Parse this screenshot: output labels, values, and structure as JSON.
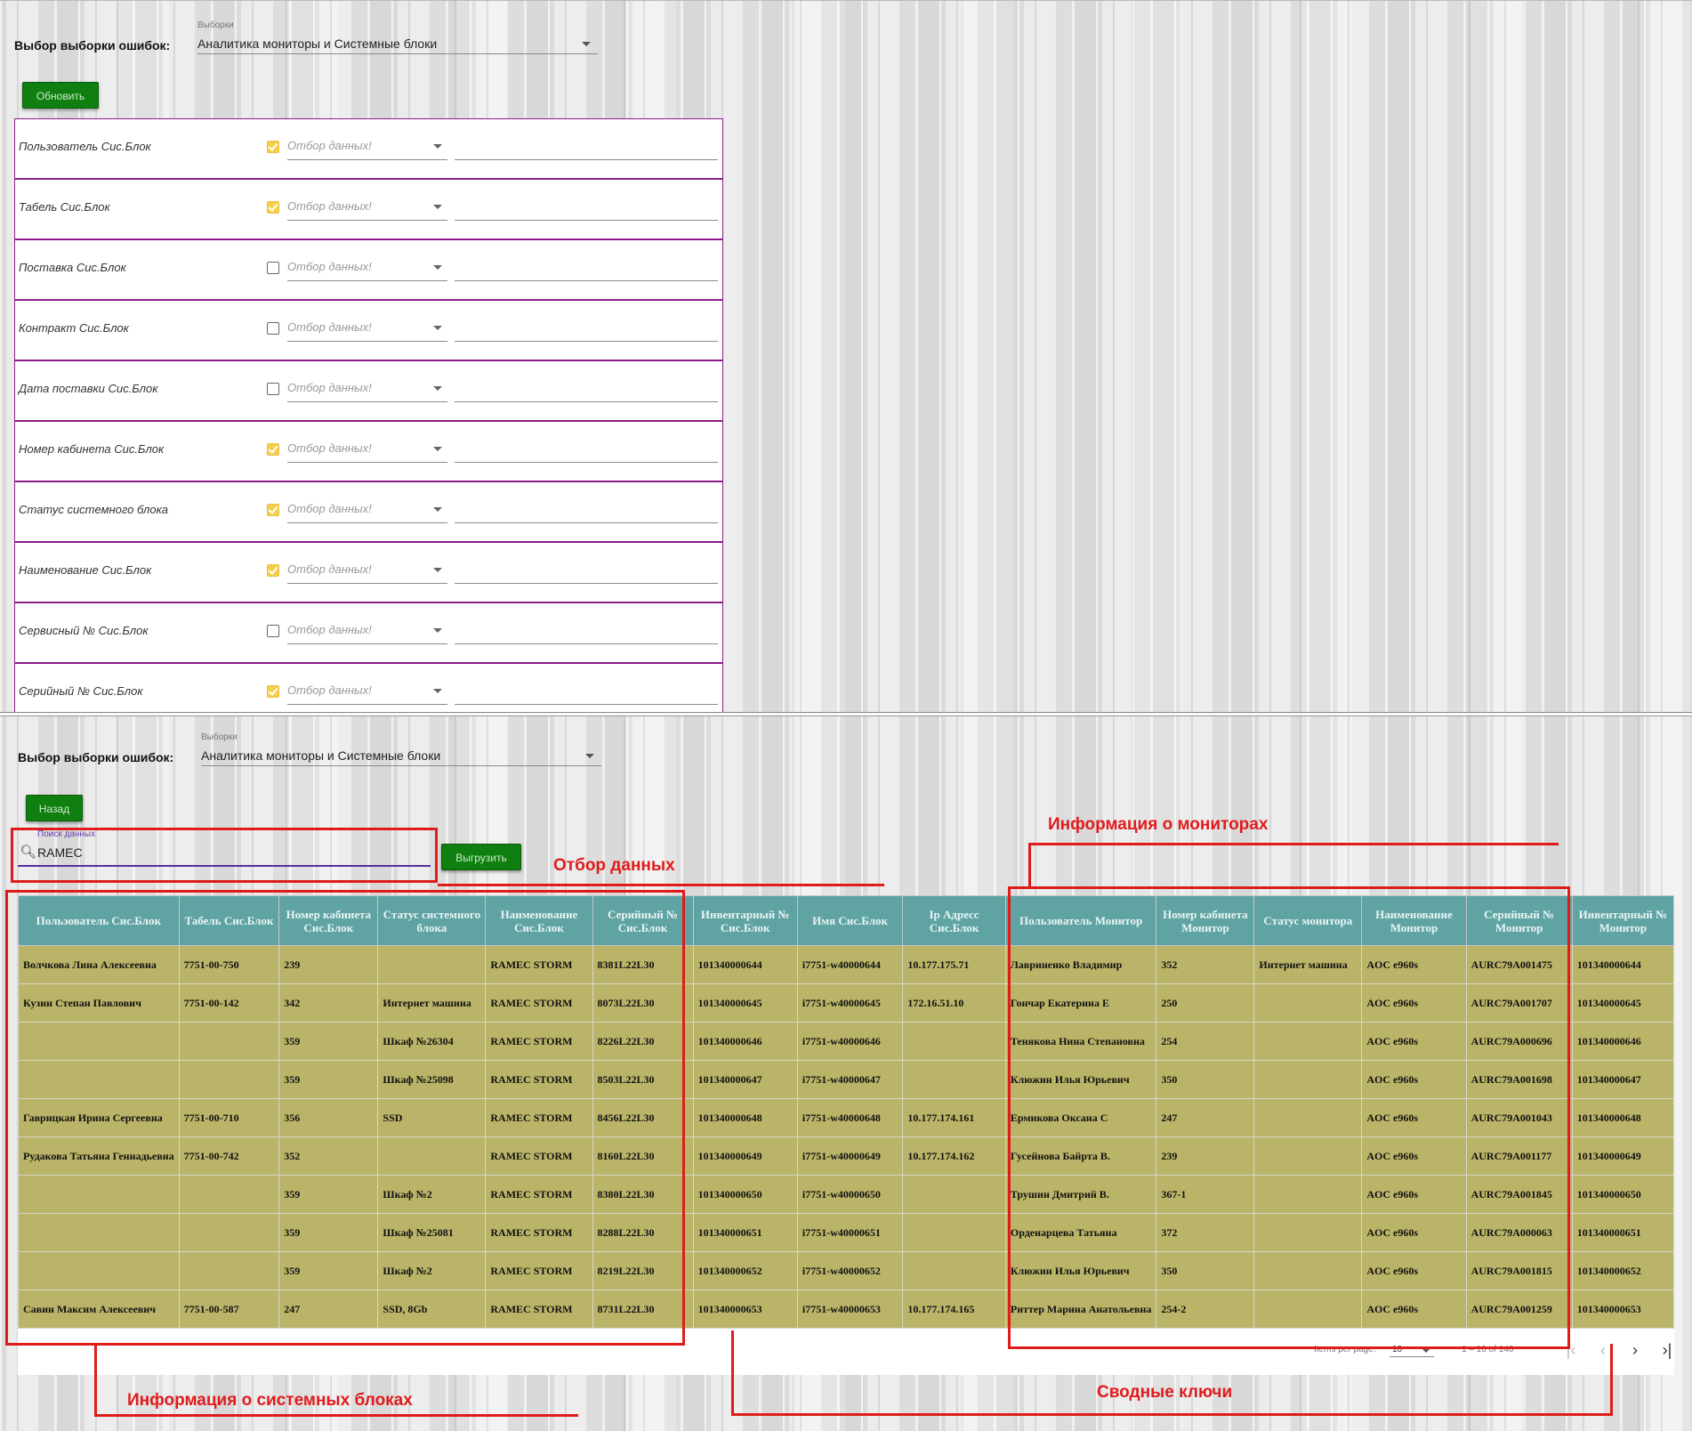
{
  "top": {
    "selector_label": "Выбор выборки ошибок:",
    "selector_caption": "Выборки",
    "selector_value": "Аналитика мониторы и Системные блоки",
    "refresh_button": "Обновить",
    "filter_placeholder": "Отбор данных!",
    "filters": [
      {
        "label": "Пользователь Сис.Блок",
        "checked": true
      },
      {
        "label": "Табель Сис.Блок",
        "checked": true
      },
      {
        "label": "Поставка Сис.Блок",
        "checked": false
      },
      {
        "label": "Контракт Сис.Блок",
        "checked": false
      },
      {
        "label": "Дата поставки Сис.Блок",
        "checked": false
      },
      {
        "label": "Номер кабинета Сис.Блок",
        "checked": true
      },
      {
        "label": "Статус системного блока",
        "checked": true
      },
      {
        "label": "Наименование Сис.Блок",
        "checked": true
      },
      {
        "label": "Сервисный № Сис.Блок",
        "checked": false
      },
      {
        "label": "Серийный № Сис.Блок",
        "checked": true
      }
    ]
  },
  "bottom": {
    "selector_label": "Выбор выборки ошибок:",
    "selector_caption": "Выборки",
    "selector_value": "Аналитика мониторы и Системные блоки",
    "back_button": "Назад",
    "search_caption": "Поиск данных",
    "search_value": "RAMEC",
    "export_button": "Выгрузить",
    "table": {
      "columns": [
        "Пользователь Сис.Блок",
        "Табель Сис.Блок",
        "Номер кабинета Сис.Блок",
        "Статус системного блока",
        "Наименование Сис.Блок",
        "Серийный № Сис.Блок",
        "Инвентарный № Сис.Блок",
        "Имя Сис.Блок",
        "Ip Адресс Сис.Блок",
        "Пользователь Монитор",
        "Номер кабинета Монитор",
        "Статус монитора",
        "Наименование Монитор",
        "Серийный № Монитор",
        "Инвентарный № Монитор"
      ],
      "rows": [
        [
          "Волчкова Лина Алексеевна",
          "7751-00-750",
          "239",
          "",
          "RAMEC STORM",
          "8381L22L30",
          "101340000644",
          "i7751-w40000644",
          "10.177.175.71",
          "Лавриненко Владимир",
          "352",
          "Интернет машина",
          "AOC e960s",
          "AURC79A001475",
          "101340000644"
        ],
        [
          "Кузин Степан Павлович",
          "7751-00-142",
          "342",
          "Интернет машина",
          "RAMEC STORM",
          "8073L22L30",
          "101340000645",
          "i7751-w40000645",
          "172.16.51.10",
          "Гончар Екатерина Е",
          "250",
          "",
          "AOC e960s",
          "AURC79A001707",
          "101340000645"
        ],
        [
          "",
          "",
          "359",
          "Шкаф №26304",
          "RAMEC STORM",
          "8226L22L30",
          "101340000646",
          "i7751-w40000646",
          "",
          "Тенякова Нина Степановна",
          "254",
          "",
          "AOC e960s",
          "AURC79A000696",
          "101340000646"
        ],
        [
          "",
          "",
          "359",
          "Шкаф №25098",
          "RAMEC STORM",
          "8503L22L30",
          "101340000647",
          "i7751-w40000647",
          "",
          "Клюжин Илья Юрьевич",
          "350",
          "",
          "AOC e960s",
          "AURC79A001698",
          "101340000647"
        ],
        [
          "Гаврицкая Ирина Сергеевна",
          "7751-00-710",
          "356",
          "SSD",
          "RAMEC STORM",
          "8456L22L30",
          "101340000648",
          "i7751-w40000648",
          "10.177.174.161",
          "Ермикова Оксана С",
          "247",
          "",
          "AOC e960s",
          "AURC79A001043",
          "101340000648"
        ],
        [
          "Рудакова Татьяна Геннадьевна",
          "7751-00-742",
          "352",
          "",
          "RAMEC STORM",
          "8160L22L30",
          "101340000649",
          "i7751-w40000649",
          "10.177.174.162",
          "Гусейнова Байрта В.",
          "239",
          "",
          "AOC e960s",
          "AURC79A001177",
          "101340000649"
        ],
        [
          "",
          "",
          "359",
          "Шкаф №2",
          "RAMEC STORM",
          "8380L22L30",
          "101340000650",
          "i7751-w40000650",
          "",
          "Трушин Дмитрий В.",
          "367-1",
          "",
          "AOC e960s",
          "AURC79A001845",
          "101340000650"
        ],
        [
          "",
          "",
          "359",
          "Шкаф №25081",
          "RAMEC STORM",
          "8288L22L30",
          "101340000651",
          "i7751-w40000651",
          "",
          "Орденарцева Татьяна",
          "372",
          "",
          "AOC e960s",
          "AURC79A000063",
          "101340000651"
        ],
        [
          "",
          "",
          "359",
          "Шкаф №2",
          "RAMEC STORM",
          "8219L22L30",
          "101340000652",
          "i7751-w40000652",
          "",
          "Клюжин Илья Юрьевич",
          "350",
          "",
          "AOC e960s",
          "AURC79A001815",
          "101340000652"
        ],
        [
          "Савин Максим Алексеевич",
          "7751-00-587",
          "247",
          "SSD, 8Gb",
          "RAMEC STORM",
          "8731L22L30",
          "101340000653",
          "i7751-w40000653",
          "10.177.174.165",
          "Риттер Марина Анатольевна",
          "254-2",
          "",
          "AOC e960s",
          "AURC79A001259",
          "101340000653"
        ]
      ]
    },
    "paginator": {
      "items_per_page_label": "Items per page:",
      "items_per_page": "10",
      "range": "1 – 10 of 140"
    },
    "annotations": {
      "monitors": "Информация о мониторах",
      "filter": "Отбор данных",
      "sysblocks": "Информация о системных блоках",
      "keys": "Сводные ключи"
    }
  },
  "colors": {
    "header_bg": "#5fa3a3",
    "cell_bg": "#bab468",
    "button_green": "#0f7f0f",
    "annotation_red": "#e01b1b",
    "filter_border": "#8a1d8a"
  }
}
